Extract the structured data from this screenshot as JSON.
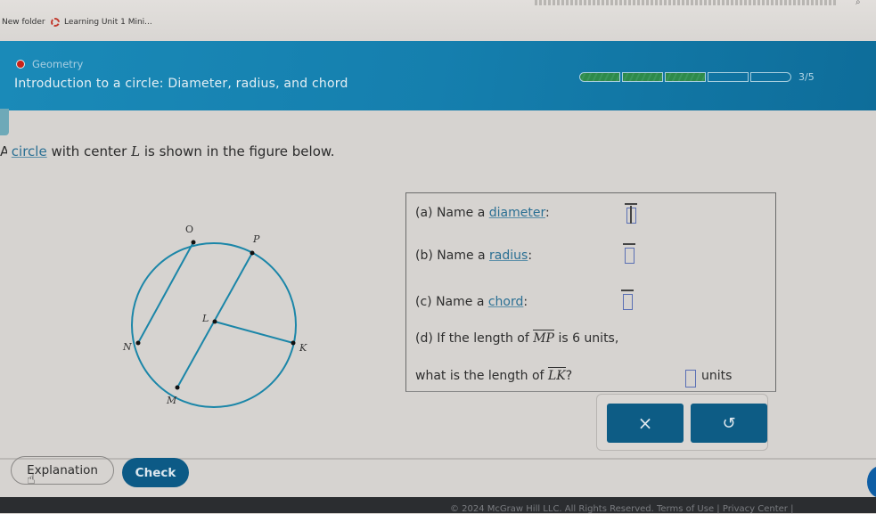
{
  "browser": {
    "bookmarks": [
      {
        "label": "New folder",
        "icon": "folder-icon"
      },
      {
        "label": "Learning Unit 1 Mini...",
        "icon": "loading-ring-icon"
      }
    ]
  },
  "header": {
    "topic": "Geometry",
    "title": "Introduction to a circle: Diameter, radius, and chord",
    "progress": {
      "completed": 3,
      "total": 5,
      "label": "3/5"
    },
    "colors": {
      "header_bg": "#157fae",
      "progress_fill": "#2e8a4a",
      "topic_dot": "#c8231a"
    }
  },
  "prompt": {
    "lead": "A",
    "link": "circle",
    "pre_var": "with center",
    "var": "L",
    "post_var": "is shown in the figure below."
  },
  "figure": {
    "center": "L",
    "points": [
      "O",
      "P",
      "N",
      "K",
      "M",
      "L"
    ],
    "segments": [
      "ON",
      "PM",
      "LK"
    ],
    "stroke_color": "#1b86a8"
  },
  "questions": {
    "a": {
      "prefix": "(a) Name a",
      "link": "diameter",
      "suffix": ":",
      "value": ""
    },
    "b": {
      "prefix": "(b) Name a",
      "link": "radius",
      "suffix": ":",
      "value": ""
    },
    "c": {
      "prefix": "(c) Name a",
      "link": "chord",
      "suffix": ":",
      "value": ""
    },
    "d": {
      "line1_pre": "(d) If the length of",
      "line1_seg": "MP",
      "line1_post": "is 6 units,",
      "line2_pre": "what is the length of",
      "line2_seg": "LK",
      "line2_post": "?",
      "unit": "units",
      "value": ""
    }
  },
  "actions": {
    "clear_icon": "×",
    "undo_icon": "↺"
  },
  "bottom": {
    "explanation_label": "Explanation",
    "check_label": "Check"
  },
  "footer": {
    "text": "© 2024 McGraw Hill LLC. All Rights Reserved.   Terms of Use  |  Privacy Center  |"
  }
}
